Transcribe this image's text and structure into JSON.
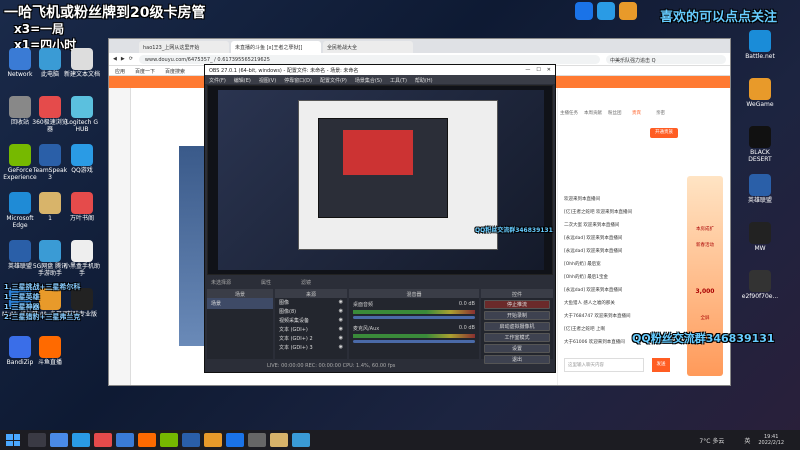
{
  "overlay": {
    "title": "一哈飞机或粉丝牌到20级卡房管",
    "line1": "x3=一局",
    "line2": "x1=四小时",
    "follow": "喜欢的可以点点关注",
    "qq_right": "QQ粉丝交流群346839131",
    "qq_mid": "QQ粉丝交流群346839131",
    "rules": [
      "1.三星挑战+三星希尔科",
      "1.三星英雄",
      "1.三星神器",
      "2.三星猎豹+三星弗兰克"
    ]
  },
  "desktop_left": [
    {
      "label": "Network",
      "color": "#3a7bd5"
    },
    {
      "label": "回收站",
      "color": "#888"
    },
    {
      "label": "GeForce Experience",
      "color": "#76b900"
    },
    {
      "label": "Microsoft Edge",
      "color": "#1f8bd6"
    },
    {
      "label": "英雄联盟",
      "color": "#2a5fa8"
    },
    {
      "label": "MuMu模拟器",
      "color": "#2a80d8"
    },
    {
      "label": "BandiZip",
      "color": "#3a6ee8"
    }
  ],
  "desktop_col2": [
    {
      "label": "此电脑",
      "color": "#3a9bd5"
    },
    {
      "label": "360极速浏览器",
      "color": "#e54b4b"
    },
    {
      "label": "TeamSpeak 3",
      "color": "#2a5fa8"
    },
    {
      "label": "1",
      "color": "#d8b46a"
    },
    {
      "label": "5G网盘 腾讯手游助手",
      "color": "#3a9bd5"
    },
    {
      "label": "MuMu多开器",
      "color": "#e89a2a"
    },
    {
      "label": "斗鱼直播",
      "color": "#ff6a00"
    }
  ],
  "desktop_col3": [
    {
      "label": "新建文本文档",
      "color": "#ddd"
    },
    {
      "label": "Logitech G HUB",
      "color": "#5bc0de"
    },
    {
      "label": "QQ游戏",
      "color": "#2a9be5"
    },
    {
      "label": "万叶书阁",
      "color": "#e54b4b"
    },
    {
      "label": "小黑盒手机助手",
      "color": "#eee"
    },
    {
      "label": "剪映专业版",
      "color": "#222"
    }
  ],
  "desktop_right": [
    {
      "label": "Battle.net",
      "color": "#1a8cd8"
    },
    {
      "label": "WeGame",
      "color": "#e89a2a"
    },
    {
      "label": "BLACK DESERT",
      "color": "#111"
    },
    {
      "label": "英雄联盟",
      "color": "#2a5fa8"
    },
    {
      "label": "MW",
      "color": "#222"
    },
    {
      "label": "e2f90f70e...",
      "color": "#333"
    }
  ],
  "browser": {
    "tabs": [
      "hao123_上网从这里开始",
      "未直播的斗鱼 [x]王者之孽狱[]",
      "全民枪战大全"
    ],
    "url": "www.douyu.com/6475357_ / 0.617395565219625",
    "bookmarks": [
      "应用",
      "百度一下",
      "百度搜索"
    ],
    "search_placeholder": "中美乐队强力追击 Q",
    "right_tabs": [
      "主播任务",
      "本周贡献",
      "粉丝团",
      "贵宾",
      "亲密"
    ],
    "open_noble": "开通贵族",
    "chat_placeholder": "这里输入聊天内容",
    "send": "发送",
    "chat": [
      "欢迎来到本直播间",
      "[亿]王者之蛇吧 欢迎来到本直播间",
      "二次大蛋 欢迎来到本直播间",
      "[永远dad] 欢迎来到本直播间",
      "[永远dad] 欢迎来到本直播间",
      "[Ohh的奶] 最后宽",
      "[Ohh的奶] 最后1宝金",
      "[永远dad] 欢迎来到本直播间",
      "大鱼猎人 感人之嘘的那关",
      "大于7684747 欢迎来到本直播间",
      "[亿]王者之蛇吧 上啊",
      "大于61006 欢迎来到本直播间"
    ],
    "ad_lines": [
      "本房成扩",
      "新春活动",
      "3,000",
      "全屏"
    ]
  },
  "obs": {
    "title": "OBS 27.0.1 (64-bit, windows) - 配置文件: 未命名 - 场景: 未命名",
    "menu": [
      "文件(F)",
      "编辑(E)",
      "视图(V)",
      "停靠窗口(D)",
      "配置文件(P)",
      "场景集合(S)",
      "工具(T)",
      "帮助(H)"
    ],
    "status_note": "未选择源",
    "properties": "属性",
    "filters": "滤镜",
    "panels": [
      "场景",
      "来源",
      "混音器",
      "转场",
      "控件"
    ],
    "scene_item": "场景",
    "sources": [
      "图像",
      "图像(8)",
      "视频采集设备",
      "文本 (GDI+)",
      "文本 (GDI+) 2",
      "文本 (GDI+) 3"
    ],
    "mixers": [
      {
        "name": "桌面音频",
        "db": "0.0 dB"
      },
      {
        "name": "麦克风/Aux",
        "db": "0.0 dB"
      }
    ],
    "controls": [
      "停止推流",
      "开始录制",
      "启动虚拟摄像机",
      "工作室模式",
      "设置",
      "退出"
    ],
    "statusbar": "LIVE: 00:00:00   REC: 00:00:00   CPU: 1.4%, 60.00 fps"
  },
  "taskbar": {
    "weather": "7°C 多云",
    "time": "19:41",
    "date": "2022/2/12",
    "lang": "英"
  }
}
